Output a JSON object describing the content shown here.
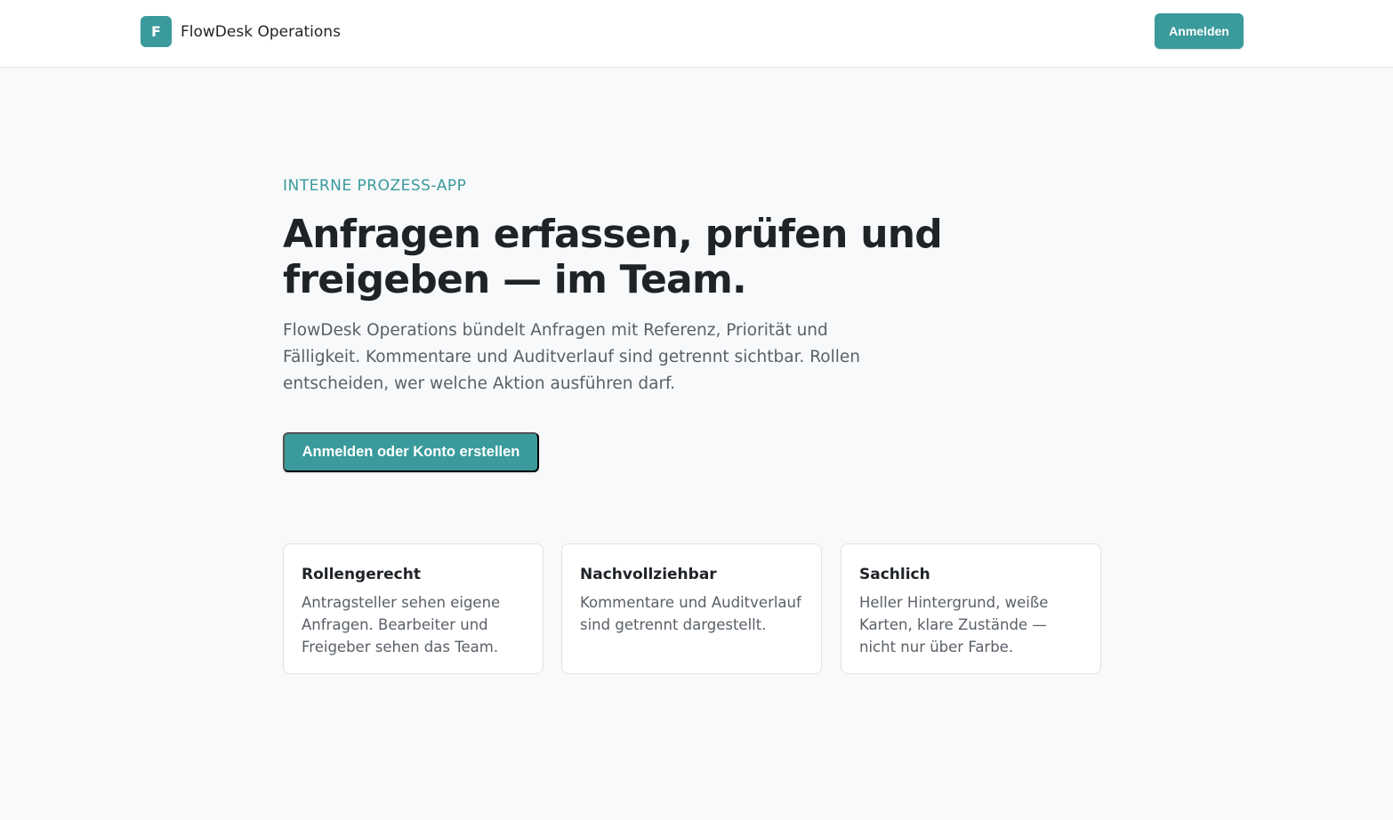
{
  "header": {
    "logo_letter": "F",
    "app_name": "FlowDesk Operations",
    "login_label": "Anmelden"
  },
  "hero": {
    "eyebrow": "INTERNE PROZESS-APP",
    "headline": "Anfragen erfassen, prüfen und freigeben — im Team.",
    "intro": "FlowDesk Operations bündelt Anfragen mit Referenz, Priorität und Fälligkeit. Kommentare und Auditverlauf sind getrennt sichtbar. Rollen entscheiden, wer welche Aktion ausführen darf.",
    "cta_label": "Anmelden oder Konto erstellen"
  },
  "features": [
    {
      "title": "Rollengerecht",
      "text": "Antragsteller sehen eigene Anfragen. Bearbeiter und Freigeber sehen das Team."
    },
    {
      "title": "Nachvollziehbar",
      "text": "Kommentare und Auditverlauf sind getrennt dargestellt."
    },
    {
      "title": "Sachlich",
      "text": "Heller Hintergrund, weiße Karten, klare Zustände — nicht nur über Farbe."
    }
  ],
  "colors": {
    "accent": "#3a9a9c",
    "background": "#f8f9fa",
    "card": "#ffffff",
    "text": "#1f2328",
    "muted_text": "#5a6068"
  }
}
